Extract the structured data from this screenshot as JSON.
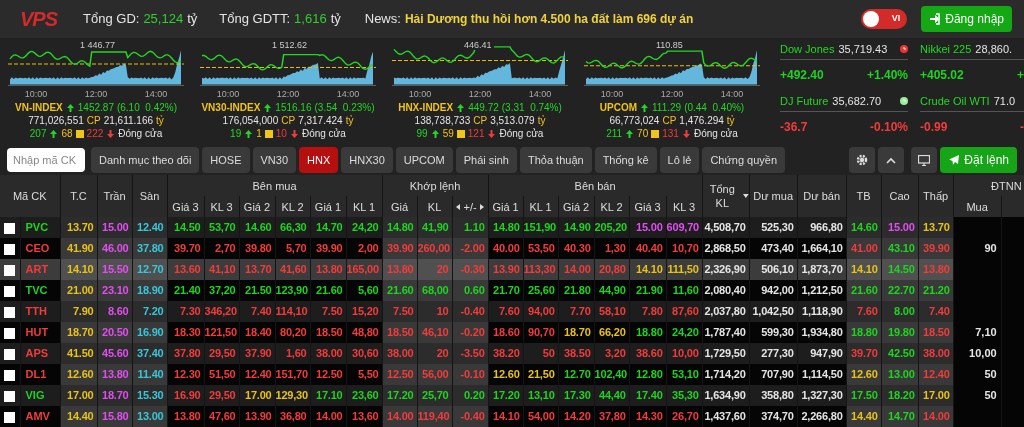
{
  "header": {
    "logo": "VPS",
    "total_label": "Tổng GD:",
    "total_value": "25,124",
    "total_unit": "tỷ",
    "deal_label": "Tổng GDTT:",
    "deal_value": "1,616",
    "deal_unit": "tỷ",
    "news_label": "News:",
    "news_text": "Hải Dương thu hồi hơn 4.500 ha đất làm 696 dự án",
    "language_toggle": {
      "label": "VI",
      "on": false
    },
    "login_button": "Đăng nhập"
  },
  "indices": [
    {
      "name": "VN-INDEX",
      "value": "1452.87",
      "change": "(6.10  0.42%)",
      "volume": "771,026,551",
      "volume_unit": "CP",
      "turnover": "21,611.166",
      "turnover_unit": "tỷ",
      "advances": "207",
      "unchanged": "68",
      "declines": "222",
      "status": "Đóng cửa",
      "ref_label": "1 446.77",
      "times": [
        "10:00",
        "12:00",
        "14:00"
      ]
    },
    {
      "name": "VN30-INDEX",
      "value": "1516.16",
      "change": "(3.54  0.23%)",
      "volume": "176,054,000",
      "volume_unit": "CP",
      "turnover": "7,317.424",
      "turnover_unit": "tỷ",
      "advances": "19",
      "unchanged": "1",
      "declines": "10",
      "status": "Đóng cửa",
      "ref_label": "1 512.62",
      "times": [
        "10:00",
        "12:00",
        "14:00"
      ]
    },
    {
      "name": "HNX-INDEX",
      "value": "449.72",
      "change": "(3.31  0.74%)",
      "volume": "138,738,733",
      "volume_unit": "CP",
      "turnover": "3,513.079",
      "turnover_unit": "tỷ",
      "advances": "99",
      "unchanged": "59",
      "declines": "121",
      "status": "Đóng cửa",
      "ref_label": "446.41",
      "times": [
        "10:00",
        "12:00",
        "14:00"
      ]
    },
    {
      "name": "UPCOM",
      "value": "111.29",
      "change": "(0.44  0.40%)",
      "volume": "66,773,024",
      "volume_unit": "CP",
      "turnover": "1,476.294",
      "turnover_unit": "tỷ",
      "advances": "211",
      "unchanged": "70",
      "declines": "131",
      "status": "Đóng cửa",
      "ref_label": "110.85",
      "times": [
        "10:00",
        "12:00",
        "14:00"
      ]
    }
  ],
  "world": [
    [
      {
        "name": "Dow Jones",
        "value": "35,719.43",
        "change": "+492.40",
        "percent": "+1.40%",
        "color": "#1ed41e",
        "clock": {
          "color": "#ee3333"
        }
      },
      {
        "name": "DJ Future",
        "value": "35,682.70",
        "change": "-36.7",
        "percent": "-0.10%",
        "color": "#f23b3b",
        "clock": {
          "color": "#99ee99"
        }
      }
    ],
    [
      {
        "name": "Nikkei 225",
        "value": "28,860.",
        "change": "+405.02",
        "percent": "+",
        "color": "#1ed41e"
      },
      {
        "name": "Crude Oil WTI",
        "value": "71.0",
        "change": "-0.99",
        "percent": "-",
        "color": "#f23b3b"
      }
    ]
  ],
  "toolbar": {
    "search": {
      "placeholder": "Nhập mã CK"
    },
    "tabs": [
      {
        "label": "Danh mục theo dõi",
        "selected": false
      },
      {
        "label": "HOSE",
        "selected": false
      },
      {
        "label": "VN30",
        "selected": false
      },
      {
        "label": "HNX",
        "selected": true
      },
      {
        "label": "HNX30",
        "selected": false
      },
      {
        "label": "UPCOM",
        "selected": false
      },
      {
        "label": "Phái sinh",
        "selected": false
      },
      {
        "label": "Thỏa thuận",
        "selected": false
      },
      {
        "label": "Thống kê",
        "selected": false
      },
      {
        "label": "Lô lẻ",
        "selected": false
      },
      {
        "label": "Chứng quyền",
        "selected": false
      }
    ],
    "order_button": "Đặt lệnh"
  },
  "table": {
    "groups": [
      "Bên mua",
      "Khớp lệnh",
      "Bên bán",
      "ĐTNN"
    ],
    "columns": [
      "Mã CK",
      "T.C",
      "Trần",
      "Sàn",
      "Giá 3",
      "KL 3",
      "Giá 2",
      "KL 2",
      "Giá 1",
      "KL 1",
      "Giá",
      "KL",
      "+/-",
      "Giá 1",
      "KL 1",
      "Giá 2",
      "KL 2",
      "Giá 3",
      "KL 3",
      "Tổng KL",
      "Dư mua",
      "Dư bán",
      "TB",
      "Cao",
      "Thấp",
      "Mua"
    ],
    "rows": [
      {
        "checked": false,
        "selected": false,
        "cells": [
          {
            "text": "PVC",
            "kind": "up"
          },
          {
            "text": "13.70",
            "kind": "reference"
          },
          {
            "text": "15.00",
            "kind": "ceiling"
          },
          {
            "text": "12.40",
            "kind": "floor"
          },
          {
            "text": "14.50",
            "kind": "up"
          },
          {
            "text": "53,70",
            "kind": "up"
          },
          {
            "text": "14.60",
            "kind": "up"
          },
          {
            "text": "66,30",
            "kind": "up"
          },
          {
            "text": "14.70",
            "kind": "up"
          },
          {
            "text": "24,20",
            "kind": "up"
          },
          {
            "text": "14.80",
            "kind": "up"
          },
          {
            "text": "41,90",
            "kind": "up"
          },
          {
            "text": "1.10",
            "kind": "up"
          },
          {
            "text": "14.80",
            "kind": "up"
          },
          {
            "text": "151,90",
            "kind": "up"
          },
          {
            "text": "14.90",
            "kind": "up"
          },
          {
            "text": "205,20",
            "kind": "up"
          },
          {
            "text": "15.00",
            "kind": "ceiling"
          },
          {
            "text": "609,70",
            "kind": "ceiling"
          },
          {
            "text": "4,508,70",
            "kind": "plain"
          },
          {
            "text": "525,30",
            "kind": "plain"
          },
          {
            "text": "966,80",
            "kind": "plain"
          },
          {
            "text": "14.60",
            "kind": "up"
          },
          {
            "text": "15.00",
            "kind": "ceiling"
          },
          {
            "text": "13.70",
            "kind": "reference"
          },
          {
            "text": ""
          }
        ]
      },
      {
        "checked": false,
        "selected": false,
        "cells": [
          {
            "text": "CEO",
            "kind": "down"
          },
          {
            "text": "41.90",
            "kind": "reference"
          },
          {
            "text": "46.00",
            "kind": "ceiling"
          },
          {
            "text": "37.80",
            "kind": "floor"
          },
          {
            "text": "39.70",
            "kind": "down"
          },
          {
            "text": "2,70",
            "kind": "down"
          },
          {
            "text": "39.80",
            "kind": "down"
          },
          {
            "text": "5,70",
            "kind": "down"
          },
          {
            "text": "39.90",
            "kind": "down"
          },
          {
            "text": "2,00",
            "kind": "down"
          },
          {
            "text": "39.90",
            "kind": "down"
          },
          {
            "text": "260,00",
            "kind": "down"
          },
          {
            "text": "-2.00",
            "kind": "down"
          },
          {
            "text": "40.00",
            "kind": "down"
          },
          {
            "text": "53,50",
            "kind": "down"
          },
          {
            "text": "40.30",
            "kind": "down"
          },
          {
            "text": "1,30",
            "kind": "down"
          },
          {
            "text": "40.40",
            "kind": "down"
          },
          {
            "text": "10,70",
            "kind": "down"
          },
          {
            "text": "2,868,50",
            "kind": "plain"
          },
          {
            "text": "473,40",
            "kind": "plain"
          },
          {
            "text": "1,664,10",
            "kind": "plain"
          },
          {
            "text": "41.00",
            "kind": "down"
          },
          {
            "text": "43.10",
            "kind": "up"
          },
          {
            "text": "39.90",
            "kind": "down"
          },
          {
            "text": "90",
            "kind": "plain"
          }
        ]
      },
      {
        "checked": false,
        "selected": true,
        "cells": [
          {
            "text": "ART",
            "kind": "down"
          },
          {
            "text": "14.10",
            "kind": "reference"
          },
          {
            "text": "15.50",
            "kind": "ceiling"
          },
          {
            "text": "12.70",
            "kind": "floor"
          },
          {
            "text": "13.60",
            "kind": "down"
          },
          {
            "text": "41,10",
            "kind": "down"
          },
          {
            "text": "13.70",
            "kind": "down"
          },
          {
            "text": "41,60",
            "kind": "down"
          },
          {
            "text": "13.80",
            "kind": "down"
          },
          {
            "text": "165,00",
            "kind": "down"
          },
          {
            "text": "13.80",
            "kind": "down"
          },
          {
            "text": "20",
            "kind": "down"
          },
          {
            "text": "-0.30",
            "kind": "down"
          },
          {
            "text": "13.90",
            "kind": "down"
          },
          {
            "text": "113,30",
            "kind": "down"
          },
          {
            "text": "14.00",
            "kind": "down"
          },
          {
            "text": "20,80",
            "kind": "down"
          },
          {
            "text": "14.10",
            "kind": "reference"
          },
          {
            "text": "111,50",
            "kind": "reference"
          },
          {
            "text": "2,326,90",
            "kind": "plain"
          },
          {
            "text": "506,10",
            "kind": "plain"
          },
          {
            "text": "1,873,70",
            "kind": "plain"
          },
          {
            "text": "14.10",
            "kind": "reference"
          },
          {
            "text": "14.50",
            "kind": "up"
          },
          {
            "text": "13.80",
            "kind": "down"
          },
          {
            "text": ""
          }
        ]
      },
      {
        "checked": false,
        "selected": false,
        "cells": [
          {
            "text": "TVC",
            "kind": "up"
          },
          {
            "text": "21.00",
            "kind": "reference"
          },
          {
            "text": "23.10",
            "kind": "ceiling"
          },
          {
            "text": "18.90",
            "kind": "floor"
          },
          {
            "text": "21.40",
            "kind": "up"
          },
          {
            "text": "37,20",
            "kind": "up"
          },
          {
            "text": "21.50",
            "kind": "up"
          },
          {
            "text": "123,90",
            "kind": "up"
          },
          {
            "text": "21.60",
            "kind": "up"
          },
          {
            "text": "5,60",
            "kind": "up"
          },
          {
            "text": "21.60",
            "kind": "up"
          },
          {
            "text": "68,00",
            "kind": "up"
          },
          {
            "text": "0.60",
            "kind": "up"
          },
          {
            "text": "21.70",
            "kind": "up"
          },
          {
            "text": "25,60",
            "kind": "up"
          },
          {
            "text": "21.80",
            "kind": "up"
          },
          {
            "text": "44,90",
            "kind": "up"
          },
          {
            "text": "21.90",
            "kind": "up"
          },
          {
            "text": "11,60",
            "kind": "up"
          },
          {
            "text": "2,080,40",
            "kind": "plain"
          },
          {
            "text": "942,00",
            "kind": "plain"
          },
          {
            "text": "1,212,50",
            "kind": "plain"
          },
          {
            "text": "21.60",
            "kind": "up"
          },
          {
            "text": "22.70",
            "kind": "up"
          },
          {
            "text": "21.20",
            "kind": "up"
          },
          {
            "text": ""
          }
        ]
      },
      {
        "checked": false,
        "selected": false,
        "cells": [
          {
            "text": "TTH",
            "kind": "down"
          },
          {
            "text": "7.90",
            "kind": "reference"
          },
          {
            "text": "8.60",
            "kind": "ceiling"
          },
          {
            "text": "7.20",
            "kind": "floor"
          },
          {
            "text": "7.30",
            "kind": "down"
          },
          {
            "text": "346,20",
            "kind": "down"
          },
          {
            "text": "7.40",
            "kind": "down"
          },
          {
            "text": "114,10",
            "kind": "down"
          },
          {
            "text": "7.50",
            "kind": "down"
          },
          {
            "text": "15,20",
            "kind": "down"
          },
          {
            "text": "7.50",
            "kind": "down"
          },
          {
            "text": "10",
            "kind": "down"
          },
          {
            "text": "-0.40",
            "kind": "down"
          },
          {
            "text": "7.60",
            "kind": "down"
          },
          {
            "text": "94,00",
            "kind": "down"
          },
          {
            "text": "7.70",
            "kind": "down"
          },
          {
            "text": "58,10",
            "kind": "down"
          },
          {
            "text": "7.80",
            "kind": "down"
          },
          {
            "text": "87,60",
            "kind": "down"
          },
          {
            "text": "2,037,80",
            "kind": "plain"
          },
          {
            "text": "1,042,50",
            "kind": "plain"
          },
          {
            "text": "1,118,90",
            "kind": "plain"
          },
          {
            "text": "7.60",
            "kind": "down"
          },
          {
            "text": "8.00",
            "kind": "up"
          },
          {
            "text": "7.40",
            "kind": "down"
          },
          {
            "text": ""
          }
        ]
      },
      {
        "checked": false,
        "selected": false,
        "cells": [
          {
            "text": "HUT",
            "kind": "down"
          },
          {
            "text": "18.70",
            "kind": "reference"
          },
          {
            "text": "20.50",
            "kind": "ceiling"
          },
          {
            "text": "16.90",
            "kind": "floor"
          },
          {
            "text": "18.30",
            "kind": "down"
          },
          {
            "text": "121,50",
            "kind": "down"
          },
          {
            "text": "18.40",
            "kind": "down"
          },
          {
            "text": "80,20",
            "kind": "down"
          },
          {
            "text": "18.50",
            "kind": "down"
          },
          {
            "text": "48,80",
            "kind": "down"
          },
          {
            "text": "18.50",
            "kind": "down"
          },
          {
            "text": "46,10",
            "kind": "down"
          },
          {
            "text": "-0.20",
            "kind": "down"
          },
          {
            "text": "18.60",
            "kind": "down"
          },
          {
            "text": "90,70",
            "kind": "down"
          },
          {
            "text": "18.70",
            "kind": "reference"
          },
          {
            "text": "66,20",
            "kind": "reference"
          },
          {
            "text": "18.80",
            "kind": "up"
          },
          {
            "text": "24,20",
            "kind": "up"
          },
          {
            "text": "1,787,40",
            "kind": "plain"
          },
          {
            "text": "599,30",
            "kind": "plain"
          },
          {
            "text": "1,934,80",
            "kind": "plain"
          },
          {
            "text": "18.80",
            "kind": "up"
          },
          {
            "text": "19.80",
            "kind": "up"
          },
          {
            "text": "18.50",
            "kind": "down"
          },
          {
            "text": "7,10",
            "kind": "plain"
          }
        ]
      },
      {
        "checked": false,
        "selected": false,
        "cells": [
          {
            "text": "APS",
            "kind": "down"
          },
          {
            "text": "41.50",
            "kind": "reference"
          },
          {
            "text": "45.60",
            "kind": "ceiling"
          },
          {
            "text": "37.40",
            "kind": "floor"
          },
          {
            "text": "37.80",
            "kind": "down"
          },
          {
            "text": "29,50",
            "kind": "down"
          },
          {
            "text": "37.90",
            "kind": "down"
          },
          {
            "text": "1,60",
            "kind": "down"
          },
          {
            "text": "38.00",
            "kind": "down"
          },
          {
            "text": "30,60",
            "kind": "down"
          },
          {
            "text": "38.00",
            "kind": "down"
          },
          {
            "text": "20",
            "kind": "down"
          },
          {
            "text": "-3.50",
            "kind": "down"
          },
          {
            "text": "38.20",
            "kind": "down"
          },
          {
            "text": "50",
            "kind": "down"
          },
          {
            "text": "38.50",
            "kind": "down"
          },
          {
            "text": "3,20",
            "kind": "down"
          },
          {
            "text": "38.60",
            "kind": "down"
          },
          {
            "text": "10,00",
            "kind": "down"
          },
          {
            "text": "1,729,50",
            "kind": "plain"
          },
          {
            "text": "277,30",
            "kind": "plain"
          },
          {
            "text": "947,90",
            "kind": "plain"
          },
          {
            "text": "39.70",
            "kind": "down"
          },
          {
            "text": "42.50",
            "kind": "up"
          },
          {
            "text": "38.00",
            "kind": "down"
          },
          {
            "text": "10,00",
            "kind": "plain"
          }
        ]
      },
      {
        "checked": false,
        "selected": false,
        "cells": [
          {
            "text": "DL1",
            "kind": "down"
          },
          {
            "text": "12.60",
            "kind": "reference"
          },
          {
            "text": "13.80",
            "kind": "ceiling"
          },
          {
            "text": "11.40",
            "kind": "floor"
          },
          {
            "text": "12.30",
            "kind": "down"
          },
          {
            "text": "51,50",
            "kind": "down"
          },
          {
            "text": "12.40",
            "kind": "down"
          },
          {
            "text": "151,70",
            "kind": "down"
          },
          {
            "text": "12.50",
            "kind": "down"
          },
          {
            "text": "5,50",
            "kind": "down"
          },
          {
            "text": "12.50",
            "kind": "down"
          },
          {
            "text": "56,00",
            "kind": "down"
          },
          {
            "text": "-0.10",
            "kind": "down"
          },
          {
            "text": "12.60",
            "kind": "reference"
          },
          {
            "text": "21,50",
            "kind": "reference"
          },
          {
            "text": "12.70",
            "kind": "up"
          },
          {
            "text": "102,40",
            "kind": "up"
          },
          {
            "text": "12.80",
            "kind": "up"
          },
          {
            "text": "53,10",
            "kind": "up"
          },
          {
            "text": "1,714,20",
            "kind": "plain"
          },
          {
            "text": "707,90",
            "kind": "plain"
          },
          {
            "text": "1,114,50",
            "kind": "plain"
          },
          {
            "text": "12.60",
            "kind": "reference"
          },
          {
            "text": "13.00",
            "kind": "up"
          },
          {
            "text": "12.40",
            "kind": "down"
          },
          {
            "text": "50",
            "kind": "plain"
          }
        ]
      },
      {
        "checked": false,
        "selected": false,
        "cells": [
          {
            "text": "VIG",
            "kind": "up"
          },
          {
            "text": "17.00",
            "kind": "reference"
          },
          {
            "text": "18.70",
            "kind": "ceiling"
          },
          {
            "text": "15.30",
            "kind": "floor"
          },
          {
            "text": "16.90",
            "kind": "down"
          },
          {
            "text": "29,50",
            "kind": "down"
          },
          {
            "text": "17.00",
            "kind": "reference"
          },
          {
            "text": "129,30",
            "kind": "reference"
          },
          {
            "text": "17.10",
            "kind": "up"
          },
          {
            "text": "23,60",
            "kind": "up"
          },
          {
            "text": "17.20",
            "kind": "up"
          },
          {
            "text": "25,70",
            "kind": "up"
          },
          {
            "text": "0.20",
            "kind": "up"
          },
          {
            "text": "17.20",
            "kind": "up"
          },
          {
            "text": "13,10",
            "kind": "up"
          },
          {
            "text": "17.30",
            "kind": "up"
          },
          {
            "text": "44,40",
            "kind": "up"
          },
          {
            "text": "17.40",
            "kind": "up"
          },
          {
            "text": "35,30",
            "kind": "up"
          },
          {
            "text": "1,634,90",
            "kind": "plain"
          },
          {
            "text": "358,80",
            "kind": "plain"
          },
          {
            "text": "1,327,30",
            "kind": "plain"
          },
          {
            "text": "17.50",
            "kind": "up"
          },
          {
            "text": "18.20",
            "kind": "up"
          },
          {
            "text": "17.00",
            "kind": "reference"
          },
          {
            "text": "50",
            "kind": "plain"
          }
        ]
      },
      {
        "checked": false,
        "selected": false,
        "cells": [
          {
            "text": "AMV",
            "kind": "down"
          },
          {
            "text": "14.40",
            "kind": "reference"
          },
          {
            "text": "15.80",
            "kind": "ceiling"
          },
          {
            "text": "13.00",
            "kind": "floor"
          },
          {
            "text": "13.80",
            "kind": "down"
          },
          {
            "text": "47,60",
            "kind": "down"
          },
          {
            "text": "13.90",
            "kind": "down"
          },
          {
            "text": "36,80",
            "kind": "down"
          },
          {
            "text": "14.00",
            "kind": "down"
          },
          {
            "text": "13,60",
            "kind": "down"
          },
          {
            "text": "14.00",
            "kind": "down"
          },
          {
            "text": "119,40",
            "kind": "down"
          },
          {
            "text": "-0.40",
            "kind": "down"
          },
          {
            "text": "14.10",
            "kind": "down"
          },
          {
            "text": "54,00",
            "kind": "down"
          },
          {
            "text": "14.20",
            "kind": "down"
          },
          {
            "text": "37,80",
            "kind": "down"
          },
          {
            "text": "14.30",
            "kind": "down"
          },
          {
            "text": "26,70",
            "kind": "down"
          },
          {
            "text": "1,437,60",
            "kind": "plain"
          },
          {
            "text": "374,70",
            "kind": "plain"
          },
          {
            "text": "2,266,80",
            "kind": "plain"
          },
          {
            "text": "14.40",
            "kind": "reference"
          },
          {
            "text": "14.70",
            "kind": "up"
          },
          {
            "text": "14.00",
            "kind": "down"
          },
          {
            "text": ""
          }
        ]
      }
    ]
  }
}
